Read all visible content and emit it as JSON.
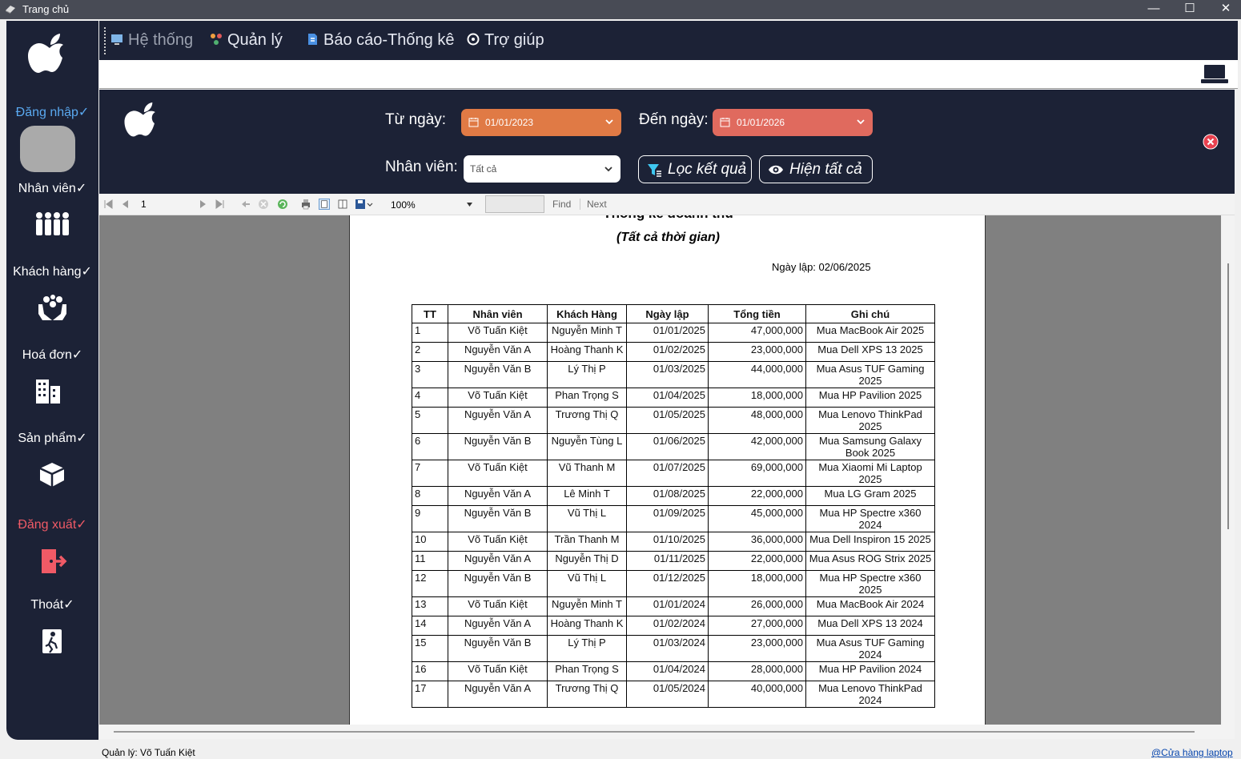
{
  "window": {
    "title": "Trang chủ",
    "minimize": "—",
    "maximize": "☐",
    "close": "✕"
  },
  "sidebar": {
    "items": [
      {
        "label": "Đăng nhập✓",
        "color": "#5aa9f0"
      },
      {
        "label": "Nhân viên✓",
        "color": "#ffffff"
      },
      {
        "label": "Khách hàng✓",
        "color": "#ffffff"
      },
      {
        "label": "Hoá đơn✓",
        "color": "#ffffff"
      },
      {
        "label": "Sản phẩm✓",
        "color": "#ffffff"
      },
      {
        "label": "Đăng xuất✓",
        "color": "#f05a66"
      },
      {
        "label": "Thoát✓",
        "color": "#ffffff"
      }
    ]
  },
  "menu": {
    "items": [
      {
        "label": "Hệ thống",
        "icon": "system-icon"
      },
      {
        "label": "Quản lý",
        "icon": "manage-icon"
      },
      {
        "label": "Báo cáo-Thống kê",
        "icon": "report-icon"
      },
      {
        "label": "Trợ giúp",
        "icon": "help-icon"
      }
    ]
  },
  "filter": {
    "from_label": "Từ ngày:",
    "from_value": "01/01/2023",
    "to_label": "Đến ngày:",
    "to_value": "01/01/2026",
    "staff_label": "Nhân viên:",
    "staff_value": "Tất cả",
    "filter_button": "Lọc kết quả",
    "show_all_button": "Hiện tất cả",
    "colors": {
      "from": "#e07a45",
      "to": "#e06a5e",
      "background": "#1c2236"
    }
  },
  "toolbar": {
    "page": "1",
    "zoom": "100%",
    "find": "Find",
    "next": "Next"
  },
  "report": {
    "title": "Thống kê doanh thu",
    "subtitle": "(Tất cả thời gian)",
    "date_created": "Ngày lập: 02/06/2025",
    "columns": [
      "TT",
      "Nhân viên",
      "Khách Hàng",
      "Ngày lập",
      "Tổng tiền",
      "Ghi chú"
    ],
    "rows": [
      [
        "1",
        "Võ Tuấn Kiệt",
        "Nguyễn Minh T",
        "01/01/2025",
        "47,000,000",
        "Mua MacBook Air 2025"
      ],
      [
        "2",
        "Nguyễn Văn A",
        "Hoàng Thanh K",
        "01/02/2025",
        "23,000,000",
        "Mua Dell XPS 13 2025"
      ],
      [
        "3",
        "Nguyễn Văn B",
        "Lý Thị P",
        "01/03/2025",
        "44,000,000",
        "Mua Asus TUF Gaming 2025"
      ],
      [
        "4",
        "Võ Tuấn Kiệt",
        "Phan Trọng S",
        "01/04/2025",
        "18,000,000",
        "Mua HP Pavilion 2025"
      ],
      [
        "5",
        "Nguyễn Văn A",
        "Trương Thị Q",
        "01/05/2025",
        "48,000,000",
        "Mua Lenovo ThinkPad 2025"
      ],
      [
        "6",
        "Nguyễn Văn B",
        "Nguyễn Tùng L",
        "01/06/2025",
        "42,000,000",
        "Mua Samsung Galaxy Book 2025"
      ],
      [
        "7",
        "Võ Tuấn Kiệt",
        "Vũ Thanh M",
        "01/07/2025",
        "69,000,000",
        "Mua Xiaomi Mi Laptop 2025"
      ],
      [
        "8",
        "Nguyễn Văn A",
        "Lê Minh T",
        "01/08/2025",
        "22,000,000",
        "Mua LG Gram 2025"
      ],
      [
        "9",
        "Nguyễn Văn B",
        "Vũ Thị L",
        "01/09/2025",
        "45,000,000",
        "Mua HP Spectre x360 2024"
      ],
      [
        "10",
        "Võ Tuấn Kiệt",
        "Trần Thanh M",
        "01/10/2025",
        "36,000,000",
        "Mua Dell Inspiron 15 2025"
      ],
      [
        "11",
        "Nguyễn Văn A",
        "Nguyễn Thị D",
        "01/11/2025",
        "22,000,000",
        "Mua Asus ROG Strix 2025"
      ],
      [
        "12",
        "Nguyễn Văn B",
        "Vũ Thị L",
        "01/12/2025",
        "18,000,000",
        "Mua HP Spectre x360 2025"
      ],
      [
        "13",
        "Võ Tuấn Kiệt",
        "Nguyễn Minh T",
        "01/01/2024",
        "26,000,000",
        "Mua MacBook Air 2024"
      ],
      [
        "14",
        "Nguyễn Văn A",
        "Hoàng Thanh K",
        "01/02/2024",
        "27,000,000",
        "Mua Dell XPS 13 2024"
      ],
      [
        "15",
        "Nguyễn Văn B",
        "Lý Thị P",
        "01/03/2024",
        "23,000,000",
        "Mua Asus TUF Gaming 2024"
      ],
      [
        "16",
        "Võ Tuấn Kiệt",
        "Phan Trọng S",
        "01/04/2024",
        "28,000,000",
        "Mua HP Pavilion 2024"
      ],
      [
        "17",
        "Nguyễn Văn A",
        "Trương Thị Q",
        "01/05/2024",
        "40,000,000",
        "Mua Lenovo ThinkPad 2024"
      ]
    ]
  },
  "status": {
    "manager": "Quản lý: Võ Tuấn Kiệt",
    "store_link": "@Cửa hàng laptop"
  }
}
